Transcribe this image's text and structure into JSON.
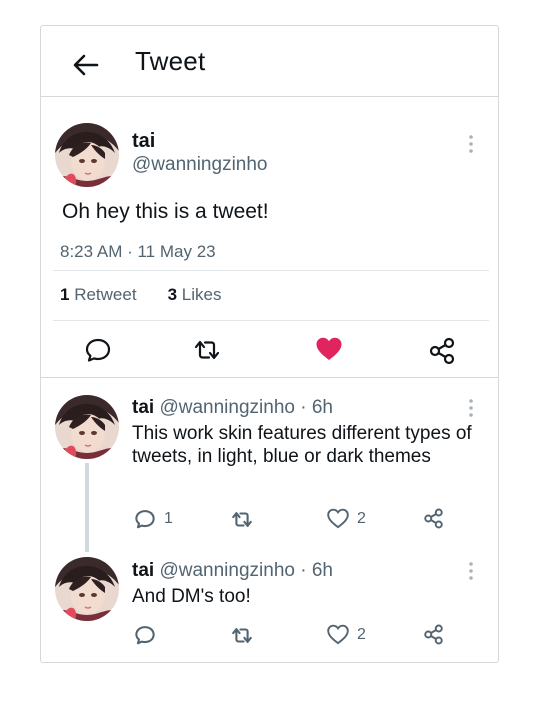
{
  "header": {
    "title": "Tweet",
    "back_icon": "arrow-left-icon"
  },
  "main_tweet": {
    "name": "tai",
    "handle": "@wanningzinho",
    "text": "Oh hey this is a tweet!",
    "timestamp": "8:23 AM · 11 May 23",
    "retweet_count": "1",
    "retweet_label": "Retweet",
    "likes_count": "3",
    "likes_label": "Likes",
    "liked": true,
    "like_color": "#e0245e"
  },
  "replies": [
    {
      "name": "tai",
      "handle": "@wanningzinho",
      "separator": "·",
      "time": "6h",
      "text": "This work skin features different types of tweets, in light, blue or dark themes",
      "reply_count": "1",
      "like_count": "2"
    },
    {
      "name": "tai",
      "handle": "@wanningzinho",
      "separator": "·",
      "time": "6h",
      "text": "And DM's too!",
      "reply_count": "",
      "like_count": "2"
    }
  ],
  "colors": {
    "text": "#0f1419",
    "secondary": "#536471",
    "border": "#d6d9dc",
    "like": "#e0245e"
  }
}
